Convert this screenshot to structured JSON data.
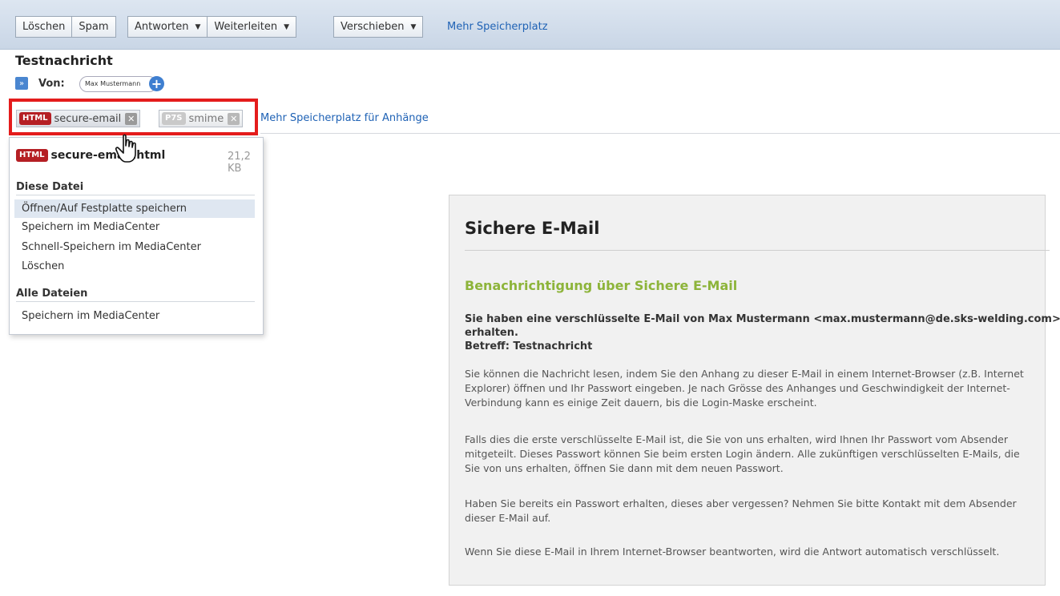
{
  "toolbar": {
    "buttons": {
      "delete": "Löschen",
      "spam": "Spam",
      "reply": "Antworten",
      "forward": "Weiterleiten",
      "move": "Verschieben"
    },
    "caret": "▼",
    "more_storage": "Mehr Speicherplatz"
  },
  "message": {
    "subject": "Testnachricht",
    "from_label": "Von:",
    "sender": "Max Mustermann",
    "add_contact": "+",
    "expand": "»"
  },
  "attachments": {
    "items": [
      {
        "badge": "HTML",
        "name": "secure-email",
        "remove": "✕"
      },
      {
        "badge": "P7S",
        "name": "smime",
        "remove": "✕"
      }
    ],
    "more_storage_link": "Mehr Speicherplatz für Anhänge"
  },
  "dropdown": {
    "file_badge": "HTML",
    "file_name": "secure-email.html",
    "file_size": "21,2 KB",
    "this_file_heading": "Diese Datei",
    "this_file_items": [
      "Öffnen/Auf Festplatte speichern",
      "Speichern im MediaCenter",
      "Schnell-Speichern im MediaCenter",
      "Löschen"
    ],
    "all_files_heading": "Alle Dateien",
    "all_files_items": [
      "Speichern im MediaCenter"
    ]
  },
  "email_body": {
    "title": "Sichere E-Mail",
    "subtitle": "Benachrichtigung über Sichere E-Mail",
    "lead": "Sie haben eine verschlüsselte E-Mail von Max Mustermann <max.mustermann@de.sks-welding.com> erhalten.",
    "subject_line": "Betreff: Testnachricht",
    "paragraphs": [
      "Sie können die Nachricht lesen, indem Sie den Anhang zu dieser E-Mail in einem Internet-Browser (z.B. Internet Explorer) öffnen und Ihr Passwort eingeben. Je nach Grösse des Anhanges und Geschwindigkeit der Internet-Verbindung kann es einige Zeit dauern, bis die Login-Maske erscheint.",
      "Falls dies die erste verschlüsselte E-Mail ist, die Sie von uns erhalten, wird Ihnen Ihr Passwort vom Absender mitgeteilt. Dieses Passwort können Sie beim ersten Login ändern. Alle zukünftigen verschlüsselten E-Mails, die Sie von uns erhalten, öffnen Sie dann mit dem neuen Passwort.",
      "Haben Sie bereits ein Passwort erhalten, dieses aber vergessen? Nehmen Sie bitte Kontakt mit dem Absender dieser E-Mail auf.",
      "Wenn Sie diese E-Mail in Ihrem Internet-Browser beantworten, wird die Antwort automatisch verschlüsselt."
    ]
  },
  "colors": {
    "highlight_border": "#e41c1c",
    "html_badge": "#b51f24",
    "link": "#1f62b5",
    "subtitle_green": "#8db43a"
  }
}
